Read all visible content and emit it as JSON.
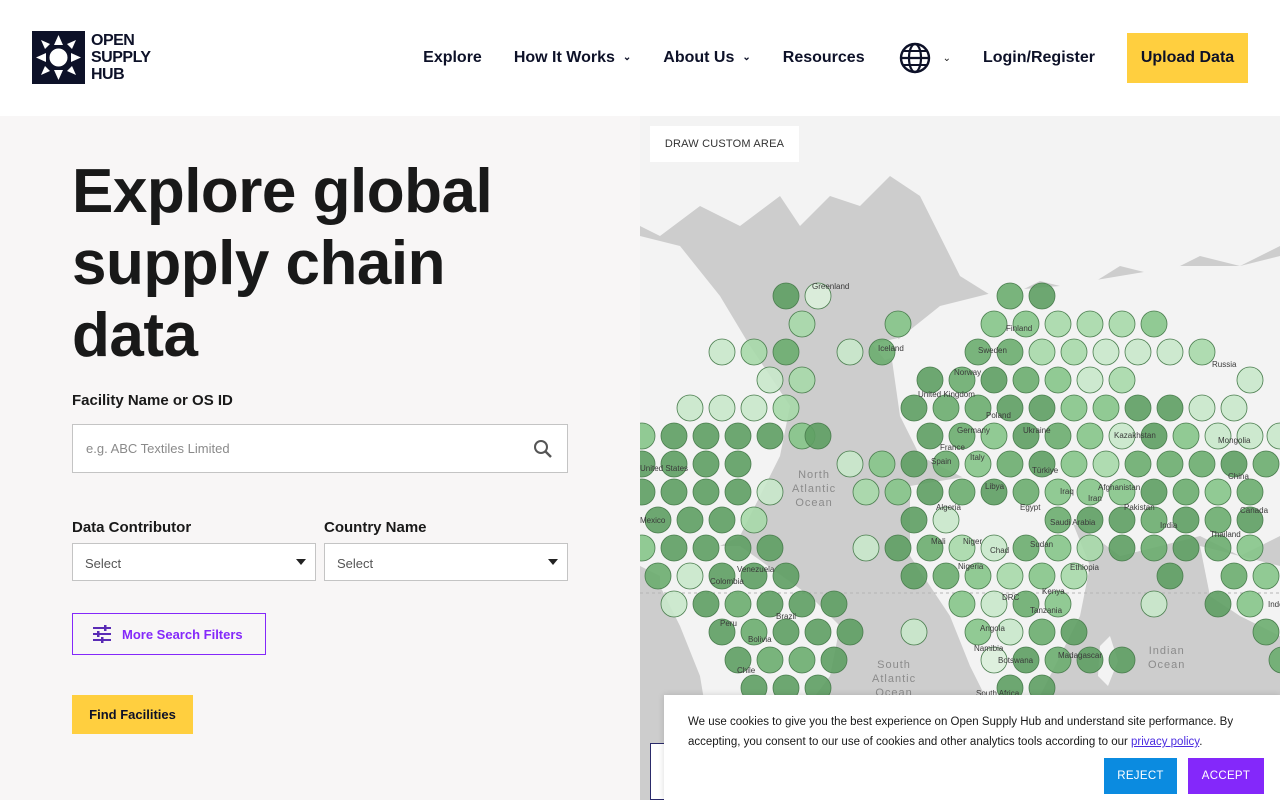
{
  "brand": {
    "logo_lines": [
      "OPEN",
      "SUPPLY",
      "HUB"
    ],
    "colors": {
      "navy": "#0d1128",
      "yellow": "#ffcf3f",
      "purple": "#8428fa",
      "blue": "#0b8be0"
    }
  },
  "nav": {
    "explore": "Explore",
    "how_it_works": "How It Works",
    "about_us": "About Us",
    "resources": "Resources",
    "login": "Login/Register",
    "upload": "Upload Data"
  },
  "hero": {
    "title_lines": [
      "Explore global",
      "supply chain",
      "data"
    ]
  },
  "search": {
    "label": "Facility Name or OS ID",
    "placeholder": "e.g. ABC Textiles Limited"
  },
  "filters": {
    "contributor_label": "Data Contributor",
    "contributor_value": "Select",
    "country_label": "Country Name",
    "country_value": "Select",
    "more_filters": "More Search Filters",
    "find": "Find Facilities"
  },
  "map": {
    "draw_custom_area": "DRAW CUSTOM AREA",
    "place_labels": [
      "Greenland",
      "Iceland",
      "Finland",
      "Sweden",
      "Norway",
      "Russia",
      "United Kingdom",
      "Poland",
      "Ukraine",
      "Germany",
      "France",
      "Kazakhstan",
      "Mongolia",
      "Spain",
      "Italy",
      "Türkiye",
      "China",
      "United States",
      "Iraq",
      "Iran",
      "Afghanistan",
      "Pakistan",
      "Algeria",
      "Libya",
      "Egypt",
      "Saudi Arabia",
      "India",
      "Thailand",
      "Mexico",
      "Mali",
      "Niger",
      "Chad",
      "Sudan",
      "Ethiopia",
      "Venezuela",
      "Colombia",
      "Nigeria",
      "DRC",
      "Kenya",
      "Tanzania",
      "Peru",
      "Brazil",
      "Bolivia",
      "Angola",
      "Namibia",
      "Botswana",
      "Madagascar",
      "Chile",
      "South Africa",
      "Canada",
      "Indo"
    ],
    "oceans": [
      {
        "lines": [
          "North",
          "Atlantic",
          "Ocean"
        ]
      },
      {
        "lines": [
          "South",
          "Atlantic",
          "Ocean"
        ]
      },
      {
        "lines": [
          "Indian",
          "Ocean"
        ]
      }
    ]
  },
  "cookie": {
    "text_before": "We use cookies to give you the best experience on Open Supply Hub and understand site performance. By accepting, you consent to our use of cookies and other analytics tools according to our",
    "link": "privacy policy",
    "text_after": ".",
    "reject": "REJECT",
    "accept": "ACCEPT"
  }
}
